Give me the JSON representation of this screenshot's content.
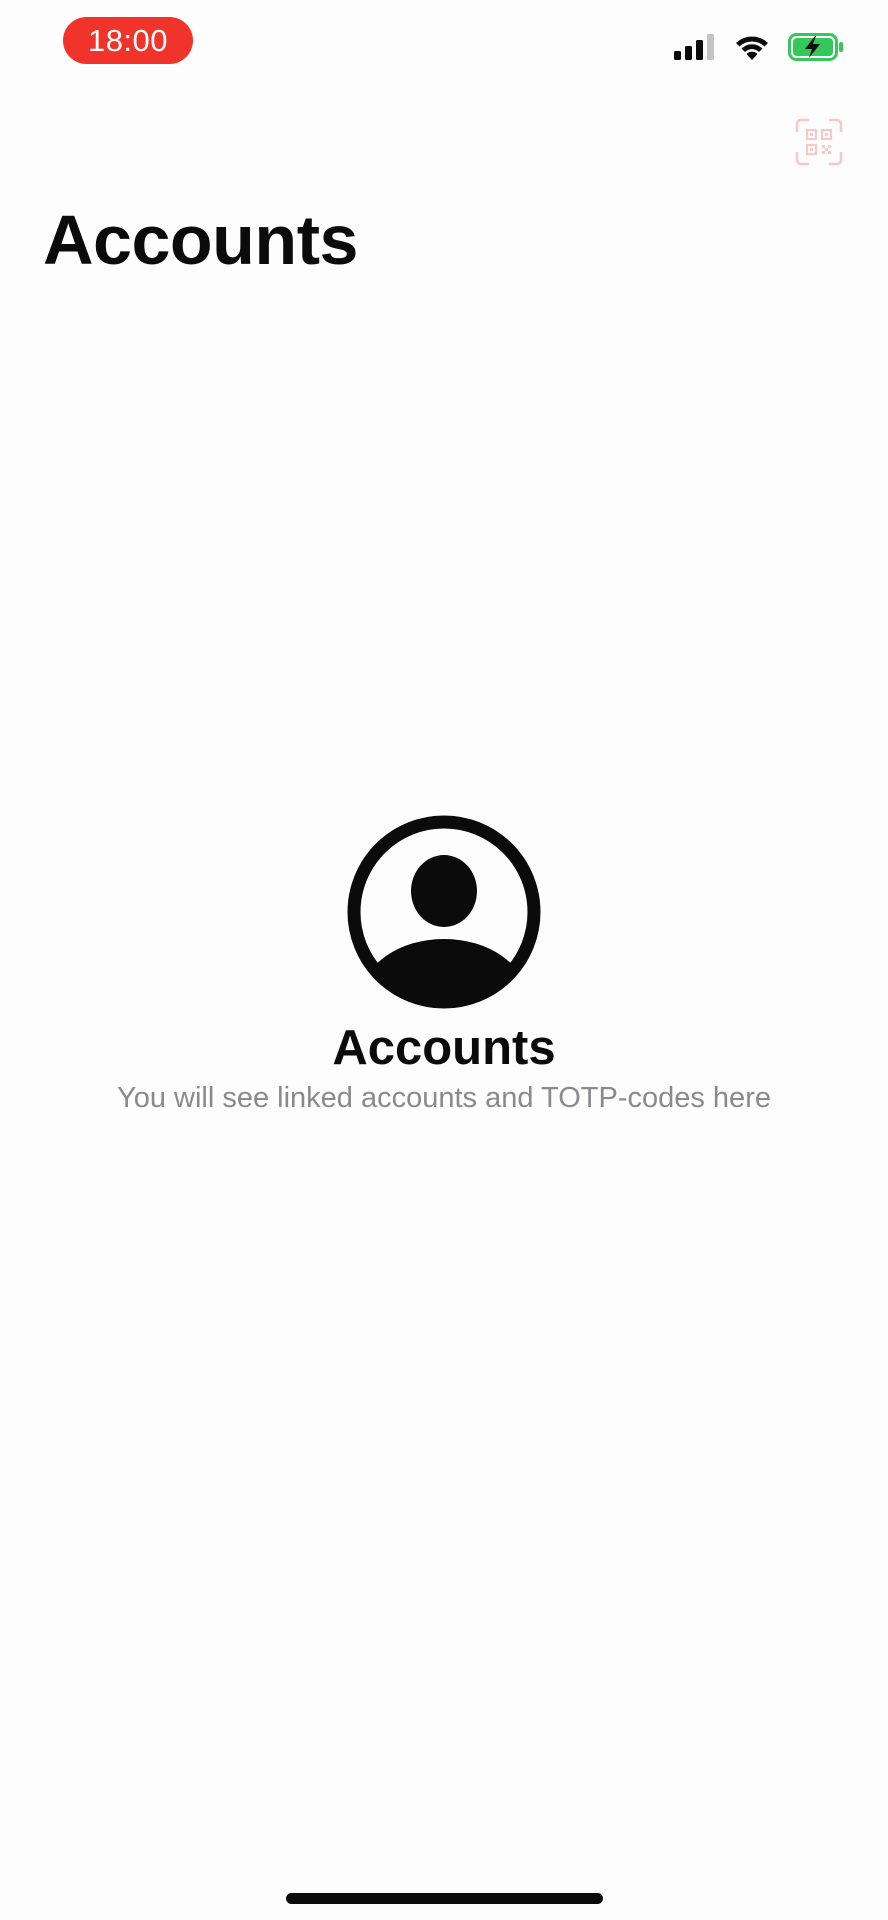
{
  "status_bar": {
    "time": "18:00",
    "time_pill_color": "#f0342b",
    "signal_icon": "cellular-signal-icon",
    "wifi_icon": "wifi-icon",
    "battery_icon": "battery-charging-icon",
    "battery_color": "#34c759"
  },
  "header": {
    "title": "Accounts",
    "scan_button_icon": "qr-code-scan-icon",
    "scan_button_color": "#f6c9c6"
  },
  "empty_state": {
    "icon": "person-circle-icon",
    "title": "Accounts",
    "subtitle": "You will see linked accounts and TOTP-codes here"
  }
}
